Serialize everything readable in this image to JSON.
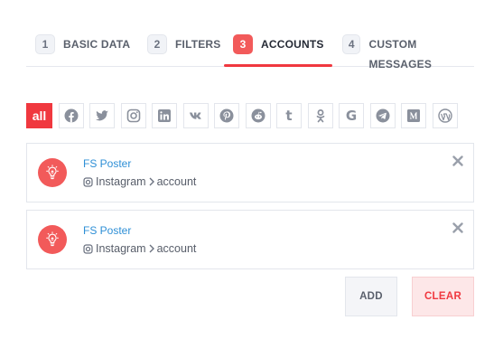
{
  "steps": [
    {
      "num": "1",
      "label": "BASIC DATA"
    },
    {
      "num": "2",
      "label": "FILTERS"
    },
    {
      "num": "3",
      "label": "ACCOUNTS"
    },
    {
      "num": "4",
      "label": "CUSTOM MESSAGES"
    }
  ],
  "active_step": "ACCOUNTS",
  "filters": {
    "all_label": "all",
    "networks": [
      "facebook",
      "twitter",
      "instagram",
      "linkedin",
      "vk",
      "pinterest",
      "reddit",
      "tumblr",
      "odnoklassniki",
      "google",
      "telegram",
      "medium",
      "wordpress"
    ],
    "glyphs": {
      "tumblr": "t",
      "google": "G"
    }
  },
  "accounts": [
    {
      "name": "FS Poster",
      "network": "Instagram",
      "type": "account"
    },
    {
      "name": "FS Poster",
      "network": "Instagram",
      "type": "account"
    }
  ],
  "buttons": {
    "add": "ADD",
    "clear": "CLEAR"
  },
  "colors": {
    "accent": "#f0383f",
    "link": "#2e8fd6",
    "icon": "#8a909c"
  }
}
